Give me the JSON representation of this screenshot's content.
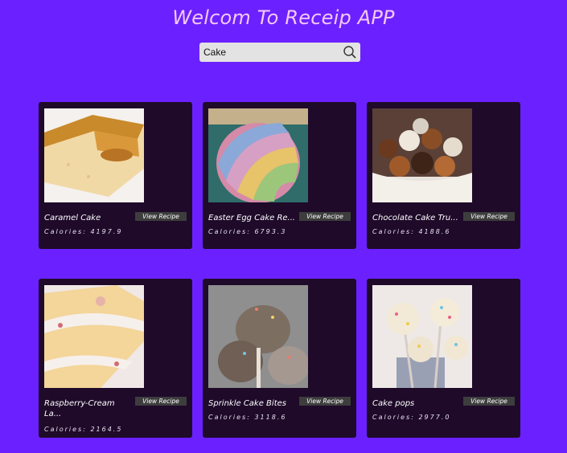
{
  "app": {
    "title": "Welcom To Receip APP"
  },
  "search": {
    "value": "Cake",
    "icon": "search-icon"
  },
  "recipes": [
    {
      "name": "Caramel Cake",
      "calories_label": "Calories: 4197.9",
      "button_label": "View Recipe"
    },
    {
      "name": "Easter Egg Cake Re...",
      "calories_label": "Calories: 6793.3",
      "button_label": "View Recipe"
    },
    {
      "name": "Chocolate Cake Tru...",
      "calories_label": "Calories: 4188.6",
      "button_label": "View Recipe"
    },
    {
      "name": "Raspberry-Cream La...",
      "calories_label": "Calories: 2164.5",
      "button_label": "View Recipe"
    },
    {
      "name": "Sprinkle Cake Bites",
      "calories_label": "Calories: 3118.6",
      "button_label": "View Recipe"
    },
    {
      "name": "Cake pops",
      "calories_label": "Calories: 2977.0",
      "button_label": "View Recipe"
    }
  ],
  "colors": {
    "background": "#6b21ff",
    "card": "#1f0a2a",
    "title": "#f3c9f5",
    "button": "#3d3d3d"
  }
}
